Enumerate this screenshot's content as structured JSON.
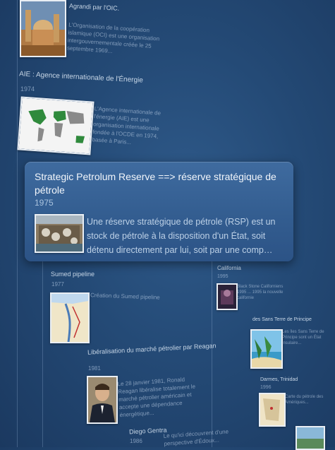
{
  "entries": {
    "oic": {
      "heading": "Agrandi par l'OIC.",
      "text": "L'Organisation de la coopération islamique (OCI) est une organisation intergouvernementale créée le 25 septembre 1969..."
    },
    "aie": {
      "title": "AIE : Agence internationale de l'Énergie",
      "year": "1974",
      "text": "L'Agence internationale de l'énergie (AIE) est une organisation internationale fondée à l'OCDE en 1974, basée à Paris..."
    },
    "sumed": {
      "title": "Sumed pipeline",
      "year": "1977",
      "text": "Création du Sumed pipeline"
    },
    "reagan": {
      "title": "Libéralisation du marché pétrolier par Reagan",
      "year": "1981",
      "text": "Le 28 janvier 1981, Ronald Reagan libéralise totalement le marché pétrolier américain et accepte une dépendance énergétique..."
    },
    "gentra": {
      "title": "Diego Gentra",
      "year": "1986",
      "text": "Le qu'ici découvrent d'une perspective d'Édoux..."
    },
    "california": {
      "title": "California",
      "year": "1995",
      "text": "Black Stone Californiens 1995 ... 1995 la nouvelle californie"
    },
    "right_island": {
      "title": "des Sans Terre de Principe",
      "text": "Les îles Sans Terre de Principe sont un État insulaire..."
    },
    "map_right": {
      "title": "Darmes, Trinidad",
      "year": "1996",
      "text": "Carte du pétrole des Amériques..."
    }
  },
  "card": {
    "title": "Strategic Petrolum Reserve ==> réserve stratégique de pétrole",
    "year": "1975",
    "text": "Une réserve stratégique de pétrole (RSP) est un stock de pétrole à la disposition d'un État, soit détenu directement par lui, soit par une comp…"
  }
}
